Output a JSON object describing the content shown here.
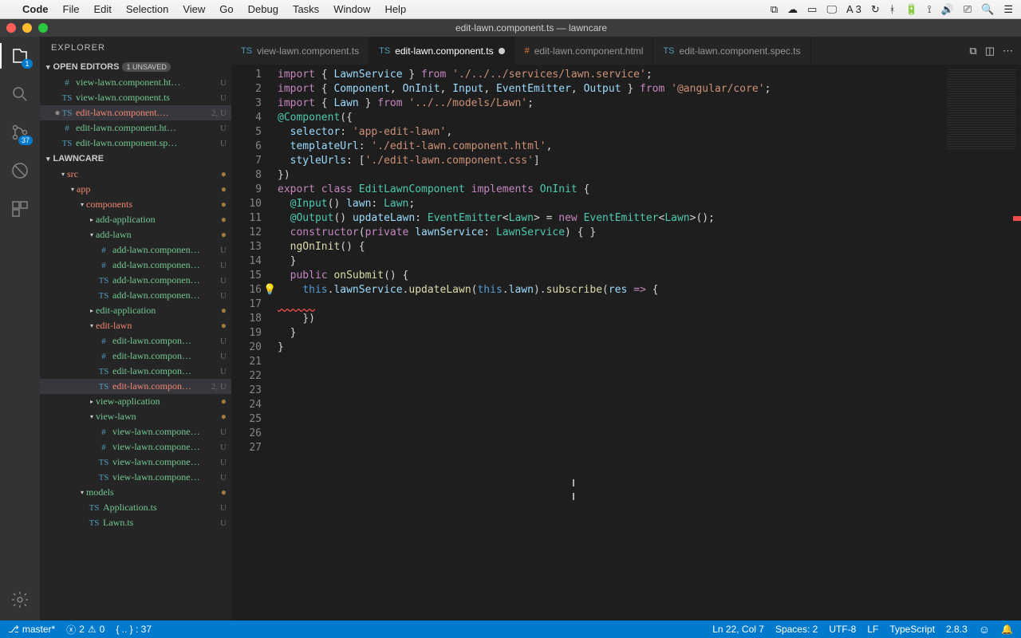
{
  "mac": {
    "app": "Code",
    "menus": [
      "File",
      "Edit",
      "Selection",
      "View",
      "Go",
      "Debug",
      "Tasks",
      "Window",
      "Help"
    ],
    "right_status": "3"
  },
  "window": {
    "title": "edit-lawn.component.ts — lawncare"
  },
  "activity": {
    "scm_badge": "37",
    "explorer_badge": "1"
  },
  "sidebar": {
    "title": "EXPLORER",
    "open_editors_hdr": "OPEN EDITORS",
    "unsaved": "1 UNSAVED",
    "workspace_hdr": "LAWNCARE",
    "open_editors": [
      {
        "icon": "#",
        "name": "view-lawn.component.ht…",
        "tag": "U",
        "cls": "unt"
      },
      {
        "icon": "TS",
        "name": "view-lawn.component.ts",
        "tag": "U",
        "cls": "unt"
      },
      {
        "icon": "TS",
        "name": "edit-lawn.component.…",
        "tag": "2, U",
        "cls": "err",
        "sel": true,
        "dirty": true
      },
      {
        "icon": "#",
        "name": "edit-lawn.component.ht…",
        "tag": "U",
        "cls": "unt"
      },
      {
        "icon": "TS",
        "name": "edit-lawn.component.sp…",
        "tag": "U",
        "cls": "unt"
      }
    ],
    "tree": [
      {
        "indent": 1,
        "chev": "▾",
        "name": "src",
        "cls": "err",
        "dot": true
      },
      {
        "indent": 2,
        "chev": "▾",
        "name": "app",
        "cls": "err",
        "dot": true
      },
      {
        "indent": 3,
        "chev": "▾",
        "name": "components",
        "cls": "err",
        "dot": true
      },
      {
        "indent": 4,
        "chev": "▸",
        "name": "add-application",
        "cls": "unt",
        "dot": true
      },
      {
        "indent": 4,
        "chev": "▾",
        "name": "add-lawn",
        "cls": "unt",
        "dot": true
      },
      {
        "indent": 5,
        "icon": "#",
        "name": "add-lawn.componen…",
        "tag": "U",
        "cls": "unt"
      },
      {
        "indent": 5,
        "icon": "#",
        "name": "add-lawn.componen…",
        "tag": "U",
        "cls": "unt"
      },
      {
        "indent": 5,
        "icon": "TS",
        "name": "add-lawn.componen…",
        "tag": "U",
        "cls": "unt"
      },
      {
        "indent": 5,
        "icon": "TS",
        "name": "add-lawn.componen…",
        "tag": "U",
        "cls": "unt"
      },
      {
        "indent": 4,
        "chev": "▸",
        "name": "edit-application",
        "cls": "unt",
        "dot": true
      },
      {
        "indent": 4,
        "chev": "▾",
        "name": "edit-lawn",
        "cls": "err",
        "dot": true
      },
      {
        "indent": 5,
        "icon": "#",
        "name": "edit-lawn.compon…",
        "tag": "U",
        "cls": "unt"
      },
      {
        "indent": 5,
        "icon": "#",
        "name": "edit-lawn.compon…",
        "tag": "U",
        "cls": "unt"
      },
      {
        "indent": 5,
        "icon": "TS",
        "name": "edit-lawn.compon…",
        "tag": "U",
        "cls": "unt"
      },
      {
        "indent": 5,
        "icon": "TS",
        "name": "edit-lawn.compon…",
        "tag": "2, U",
        "cls": "err",
        "sel": true
      },
      {
        "indent": 4,
        "chev": "▸",
        "name": "view-application",
        "cls": "unt",
        "dot": true
      },
      {
        "indent": 4,
        "chev": "▾",
        "name": "view-lawn",
        "cls": "unt",
        "dot": true
      },
      {
        "indent": 5,
        "icon": "#",
        "name": "view-lawn.compone…",
        "tag": "U",
        "cls": "unt"
      },
      {
        "indent": 5,
        "icon": "#",
        "name": "view-lawn.compone…",
        "tag": "U",
        "cls": "unt"
      },
      {
        "indent": 5,
        "icon": "TS",
        "name": "view-lawn.compone…",
        "tag": "U",
        "cls": "unt"
      },
      {
        "indent": 5,
        "icon": "TS",
        "name": "view-lawn.compone…",
        "tag": "U",
        "cls": "unt"
      },
      {
        "indent": 3,
        "chev": "▾",
        "name": "models",
        "cls": "unt",
        "dot": true
      },
      {
        "indent": 4,
        "icon": "TS",
        "name": "Application.ts",
        "tag": "U",
        "cls": "unt"
      },
      {
        "indent": 4,
        "icon": "TS",
        "name": "Lawn.ts",
        "tag": "U",
        "cls": "unt"
      }
    ]
  },
  "tabs": [
    {
      "icon": "TS",
      "label": "view-lawn.component.ts",
      "active": false
    },
    {
      "icon": "TS",
      "label": "edit-lawn.component.ts",
      "active": true,
      "dirty": true
    },
    {
      "icon": "#",
      "label": "edit-lawn.component.html",
      "active": false
    },
    {
      "icon": "TS",
      "label": "edit-lawn.component.spec.ts",
      "active": false
    }
  ],
  "code": {
    "lines": [
      {
        "n": 1,
        "seg": [
          [
            "kw",
            "import"
          ],
          [
            "pl",
            " { "
          ],
          [
            "var",
            "LawnService"
          ],
          [
            "pl",
            " } "
          ],
          [
            "kw",
            "from"
          ],
          [
            "pl",
            " "
          ],
          [
            "str",
            "'./../../services/lawn.service'"
          ],
          [
            "pl",
            ";"
          ]
        ]
      },
      {
        "n": 2,
        "seg": [
          [
            "kw",
            "import"
          ],
          [
            "pl",
            " { "
          ],
          [
            "var",
            "Component"
          ],
          [
            "pl",
            ", "
          ],
          [
            "var",
            "OnInit"
          ],
          [
            "pl",
            ", "
          ],
          [
            "var",
            "Input"
          ],
          [
            "pl",
            ", "
          ],
          [
            "var",
            "EventEmitter"
          ],
          [
            "pl",
            ", "
          ],
          [
            "var",
            "Output"
          ],
          [
            "pl",
            " } "
          ],
          [
            "kw",
            "from"
          ],
          [
            "pl",
            " "
          ],
          [
            "str",
            "'@angular/core'"
          ],
          [
            "pl",
            ";"
          ]
        ]
      },
      {
        "n": 3,
        "seg": [
          [
            "kw",
            "import"
          ],
          [
            "pl",
            " { "
          ],
          [
            "var",
            "Lawn"
          ],
          [
            "pl",
            " } "
          ],
          [
            "kw",
            "from"
          ],
          [
            "pl",
            " "
          ],
          [
            "str",
            "'../../models/Lawn'"
          ],
          [
            "pl",
            ";"
          ]
        ]
      },
      {
        "n": 4,
        "seg": [
          [
            "pl",
            ""
          ]
        ]
      },
      {
        "n": 5,
        "seg": [
          [
            "dec",
            "@Component"
          ],
          [
            "pl",
            "({"
          ]
        ]
      },
      {
        "n": 6,
        "seg": [
          [
            "pl",
            "  "
          ],
          [
            "var",
            "selector"
          ],
          [
            "pl",
            ": "
          ],
          [
            "str",
            "'app-edit-lawn'"
          ],
          [
            "pl",
            ","
          ]
        ]
      },
      {
        "n": 7,
        "seg": [
          [
            "pl",
            "  "
          ],
          [
            "var",
            "templateUrl"
          ],
          [
            "pl",
            ": "
          ],
          [
            "str",
            "'./edit-lawn.component.html'"
          ],
          [
            "pl",
            ","
          ]
        ]
      },
      {
        "n": 8,
        "seg": [
          [
            "pl",
            "  "
          ],
          [
            "var",
            "styleUrls"
          ],
          [
            "pl",
            ": ["
          ],
          [
            "str",
            "'./edit-lawn.component.css'"
          ],
          [
            "pl",
            "]"
          ]
        ]
      },
      {
        "n": 9,
        "seg": [
          [
            "pl",
            "})"
          ]
        ]
      },
      {
        "n": 10,
        "seg": [
          [
            "kw",
            "export"
          ],
          [
            "pl",
            " "
          ],
          [
            "kw",
            "class"
          ],
          [
            "pl",
            " "
          ],
          [
            "cls",
            "EditLawnComponent"
          ],
          [
            "pl",
            " "
          ],
          [
            "kw",
            "implements"
          ],
          [
            "pl",
            " "
          ],
          [
            "cls",
            "OnInit"
          ],
          [
            "pl",
            " {"
          ]
        ]
      },
      {
        "n": 11,
        "seg": [
          [
            "pl",
            ""
          ]
        ]
      },
      {
        "n": 12,
        "seg": [
          [
            "pl",
            "  "
          ],
          [
            "dec",
            "@Input"
          ],
          [
            "pl",
            "() "
          ],
          [
            "var",
            "lawn"
          ],
          [
            "pl",
            ": "
          ],
          [
            "cls",
            "Lawn"
          ],
          [
            "pl",
            ";"
          ]
        ]
      },
      {
        "n": 13,
        "seg": [
          [
            "pl",
            "  "
          ],
          [
            "dec",
            "@Output"
          ],
          [
            "pl",
            "() "
          ],
          [
            "var",
            "updateLawn"
          ],
          [
            "pl",
            ": "
          ],
          [
            "cls",
            "EventEmitter"
          ],
          [
            "pl",
            "<"
          ],
          [
            "cls",
            "Lawn"
          ],
          [
            "pl",
            "> = "
          ],
          [
            "kw",
            "new"
          ],
          [
            "pl",
            " "
          ],
          [
            "cls",
            "EventEmitter"
          ],
          [
            "pl",
            "<"
          ],
          [
            "cls",
            "Lawn"
          ],
          [
            "pl",
            ">();"
          ]
        ]
      },
      {
        "n": 14,
        "seg": [
          [
            "pl",
            ""
          ]
        ]
      },
      {
        "n": 15,
        "seg": [
          [
            "pl",
            "  "
          ],
          [
            "kw",
            "constructor"
          ],
          [
            "pl",
            "("
          ],
          [
            "kw",
            "private"
          ],
          [
            "pl",
            " "
          ],
          [
            "var",
            "lawnService"
          ],
          [
            "pl",
            ": "
          ],
          [
            "cls",
            "LawnService"
          ],
          [
            "pl",
            ") { }"
          ]
        ]
      },
      {
        "n": 16,
        "seg": [
          [
            "pl",
            ""
          ]
        ]
      },
      {
        "n": 17,
        "seg": [
          [
            "pl",
            "  "
          ],
          [
            "fn",
            "ngOnInit"
          ],
          [
            "pl",
            "() {"
          ]
        ]
      },
      {
        "n": 18,
        "seg": [
          [
            "pl",
            "  }"
          ]
        ]
      },
      {
        "n": 19,
        "seg": [
          [
            "pl",
            ""
          ]
        ]
      },
      {
        "n": 20,
        "seg": [
          [
            "pl",
            "  "
          ],
          [
            "kw",
            "public"
          ],
          [
            "pl",
            " "
          ],
          [
            "fn",
            "onSubmit"
          ],
          [
            "pl",
            "() {"
          ]
        ]
      },
      {
        "n": 21,
        "bulb": true,
        "seg": [
          [
            "pl",
            "    "
          ],
          [
            "this",
            "this"
          ],
          [
            "pl",
            "."
          ],
          [
            "var",
            "lawnService"
          ],
          [
            "pl",
            "."
          ],
          [
            "fn",
            "updateLawn"
          ],
          [
            "pl",
            "("
          ],
          [
            "this",
            "this"
          ],
          [
            "pl",
            "."
          ],
          [
            "var",
            "lawn"
          ],
          [
            "pl",
            ")."
          ],
          [
            "fn",
            "subscribe"
          ],
          [
            "pl",
            "("
          ],
          [
            "var",
            "res"
          ],
          [
            "pl",
            " "
          ],
          [
            "kw",
            "=>"
          ],
          [
            "pl",
            " {"
          ]
        ]
      },
      {
        "n": 22,
        "seg": [
          [
            "squiggle",
            "      "
          ],
          [
            "pl",
            ""
          ]
        ]
      },
      {
        "n": 23,
        "seg": [
          [
            "pl",
            "    })"
          ]
        ]
      },
      {
        "n": 24,
        "seg": [
          [
            "pl",
            "  }"
          ]
        ]
      },
      {
        "n": 25,
        "seg": [
          [
            "pl",
            ""
          ]
        ]
      },
      {
        "n": 26,
        "seg": [
          [
            "pl",
            "}"
          ]
        ]
      },
      {
        "n": 27,
        "seg": [
          [
            "pl",
            ""
          ]
        ]
      }
    ]
  },
  "status": {
    "branch": "master*",
    "errors": "2",
    "warnings": "0",
    "braces": "{ .. } : 37",
    "cursor": "Ln 22, Col 7",
    "spaces": "Spaces: 2",
    "encoding": "UTF-8",
    "eol": "LF",
    "lang": "TypeScript",
    "ts_version": "2.8.3"
  }
}
